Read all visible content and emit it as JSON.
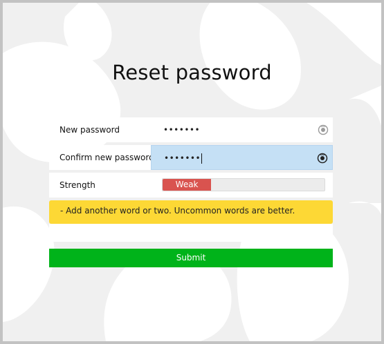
{
  "page": {
    "title": "Reset password"
  },
  "form": {
    "new_password": {
      "label": "New password",
      "value": "•••••••",
      "icon": "eye-icon"
    },
    "confirm_password": {
      "label": "Confirm new password",
      "value": "•••••••",
      "icon": "eye-icon"
    },
    "strength": {
      "label": "Strength",
      "rating": "Weak",
      "level": 0.3,
      "color": "#d9534f"
    },
    "hint": "- Add another word or two. Uncommon words are better.",
    "submit_label": "Submit"
  },
  "colors": {
    "hint_bg": "#fdd835",
    "submit_bg": "#00b31a",
    "focused_field_bg": "#c5e0f5"
  }
}
